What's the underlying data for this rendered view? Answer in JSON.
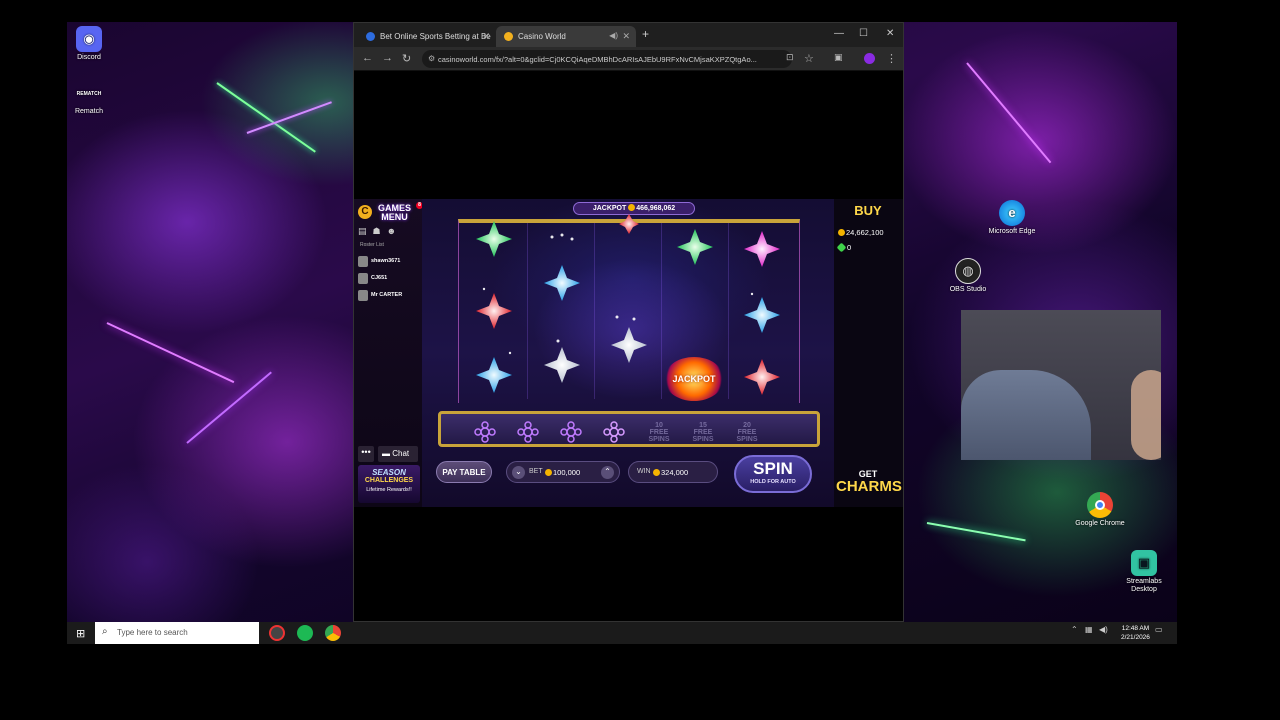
{
  "desktop": {
    "icons": [
      {
        "label": "Discord",
        "icon": "discord-icon"
      },
      {
        "label": "Rematch",
        "sublabel": "REMATCH",
        "icon": "rematch-icon"
      },
      {
        "label": "Microsoft Edge",
        "icon": "edge-icon"
      },
      {
        "label": "OBS Studio",
        "icon": "obs-icon"
      },
      {
        "label": "Google Chrome",
        "icon": "chrome-icon"
      },
      {
        "label": "Streamlabs Desktop",
        "icon": "streamlabs-icon"
      }
    ]
  },
  "browser": {
    "tabs": [
      {
        "title": "Bet Online Sports Betting at Be",
        "active": false
      },
      {
        "title": "Casino World",
        "active": true
      }
    ],
    "url": "casinoworld.com/fx/?alt=0&gclid=Cj0KCQiAqeDMBhDcARIsAJEbU9RFxNvCMjsaKXPZQtgAo..."
  },
  "game": {
    "menu": {
      "line1": "GAMES",
      "line2": "MENU",
      "badge": "8"
    },
    "roster_label": "Roster List",
    "players": [
      "shawn3671",
      "CJ651",
      "Mr CARTER"
    ],
    "chat_label": "Chat",
    "more_label": "•••",
    "season": {
      "line1": "SEASON",
      "line2": "CHALLENGES",
      "line3": "Lifetime Rewards!!"
    },
    "jackpot": {
      "label": "JACKPOT",
      "value": "466,968,062"
    },
    "jackpot_symbol": "JACKPOT",
    "free_spins": [
      {
        "line1": "10",
        "line2": "FREE",
        "line3": "SPINS"
      },
      {
        "line1": "15",
        "line2": "FREE",
        "line3": "SPINS"
      },
      {
        "line1": "20",
        "line2": "FREE",
        "line3": "SPINS"
      }
    ],
    "pay_table_label": "PAY TABLE",
    "bet": {
      "label": "BET",
      "value": "100,000"
    },
    "win": {
      "label": "WIN",
      "value": "324,000"
    },
    "spin": {
      "label": "SPIN",
      "sublabel": "HOLD FOR AUTO"
    },
    "buy_label": "BUY",
    "coins": "24,662,100",
    "gems": "0",
    "charms": {
      "line1": "GET",
      "line2": "CHARMS"
    }
  },
  "taskbar": {
    "search_placeholder": "Type here to search",
    "time": "12:48 AM",
    "date": "2/21/2026"
  },
  "colors": {
    "gold": "#c9a43a",
    "accent": "#ffd84a",
    "panel": "#0a0612"
  }
}
